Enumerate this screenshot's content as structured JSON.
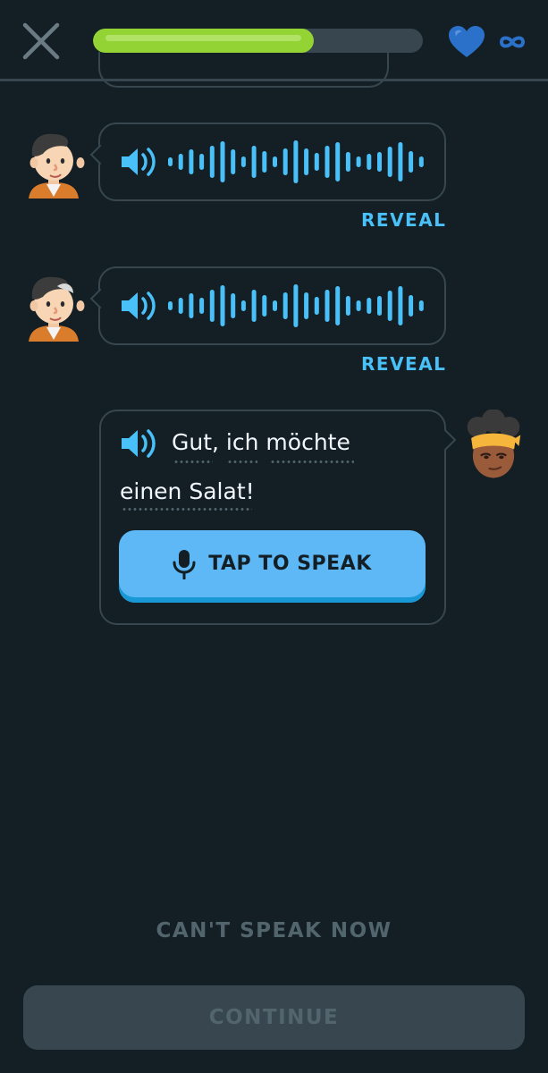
{
  "header": {
    "close_icon": "close-x-icon",
    "progress_fraction": 0.67,
    "hearts_icon": "heart-icon",
    "hearts_value": "∞",
    "colors": {
      "progress": "#93d333",
      "heart": "#1cb0f6"
    }
  },
  "messages": [
    {
      "speaker": "male-character",
      "type": "audio-waveform",
      "reveal_label": "REVEAL"
    },
    {
      "speaker": "male-character",
      "type": "audio-waveform",
      "reveal_label": "REVEAL"
    }
  ],
  "prompt": {
    "speaker": "female-character",
    "line1_words": [
      "Gut,",
      "ich",
      "möchte"
    ],
    "line2_words": [
      "einen",
      "Salat!"
    ],
    "tap_to_speak_label": "TAP TO SPEAK"
  },
  "footer": {
    "cant_speak_label": "CAN'T SPEAK NOW",
    "continue_label": "CONTINUE"
  },
  "colors": {
    "background": "#131f24",
    "accent": "#49c0f8",
    "border": "#37464f",
    "disabled_text": "#52656d"
  }
}
